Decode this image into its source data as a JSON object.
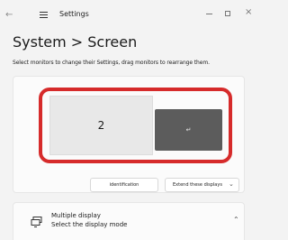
{
  "window": {
    "app_title": "Settings",
    "back_icon": "back-arrow-icon",
    "menu_icon": "hamburger-menu-icon",
    "controls": [
      "minimize-icon",
      "maximize-icon",
      "close-icon"
    ]
  },
  "header": {
    "breadcrumb": "System > Screen",
    "subtitle": "Select monitors to change their Settings, drag monitors to rearrange them."
  },
  "monitors": {
    "highlight_color": "#d62b2b",
    "items": [
      {
        "label": "2",
        "selected": false
      },
      {
        "label": "↵",
        "selected": true
      }
    ]
  },
  "actions": {
    "identify_label": "identification",
    "display_mode_value": "Extend these displays"
  },
  "multiple_display": {
    "title": "Multiple display",
    "description": "Select the display mode",
    "icon": "multiple-display-icon",
    "expanded": true
  }
}
